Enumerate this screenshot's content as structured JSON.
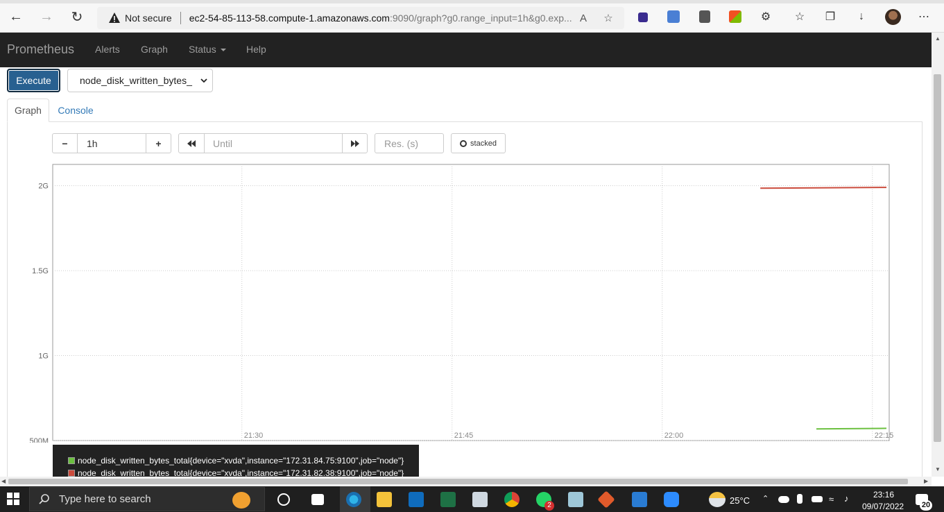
{
  "browser": {
    "security_label": "Not secure",
    "url_host": "ec2-54-85-113-58.compute-1.amazonaws.com",
    "url_rest": ":9090/graph?g0.range_input=1h&g0.exp..."
  },
  "nav": {
    "brand": "Prometheus",
    "links": [
      "Alerts",
      "Graph",
      "Status",
      "Help"
    ]
  },
  "query": {
    "execute_label": "Execute",
    "selected_metric": "node_disk_written_bytes_"
  },
  "tabs": [
    "Graph",
    "Console"
  ],
  "controls": {
    "minus": "−",
    "range": "1h",
    "plus": "+",
    "end_placeholder": "Until",
    "res_placeholder": "Res. (s)",
    "stacked_label": "stacked"
  },
  "chart_data": {
    "type": "line",
    "y_ticks": [
      "2G",
      "1.5G",
      "1G",
      "500M"
    ],
    "x_ticks": [
      "21:30",
      "21:45",
      "22:00",
      "22:15"
    ],
    "ylim": [
      500000000,
      2125000000
    ],
    "grid": true,
    "series": [
      {
        "name": "node_disk_written_bytes_total{device=\"xvda\",instance=\"172.31.82.38:9100\",job=\"node\"}",
        "color": "#cb4b3c",
        "x": [
          "22:07",
          "22:16"
        ],
        "values": [
          1985000000,
          1990000000
        ]
      },
      {
        "name": "node_disk_written_bytes_total{device=\"xvda\",instance=\"172.31.84.75:9100\",job=\"node\"}",
        "color": "#6bc03f",
        "x": [
          "22:11",
          "22:16"
        ],
        "values": [
          568000000,
          572000000
        ]
      }
    ]
  },
  "legend": {
    "items": [
      {
        "label": "node_disk_written_bytes_total{device=\"xvda\",instance=\"172.31.84.75:9100\",job=\"node\"}",
        "color": "#6bc03f"
      },
      {
        "label": "node_disk_written_bytes_total{device=\"xvda\",instance=\"172.31.82.38:9100\",job=\"node\"}",
        "color": "#cb4b3c"
      }
    ]
  },
  "taskbar": {
    "search_placeholder": "Type here to search",
    "whatsapp_badge": "2",
    "temperature": "25°C",
    "time": "23:16",
    "date": "09/07/2022",
    "notifications": "20"
  }
}
